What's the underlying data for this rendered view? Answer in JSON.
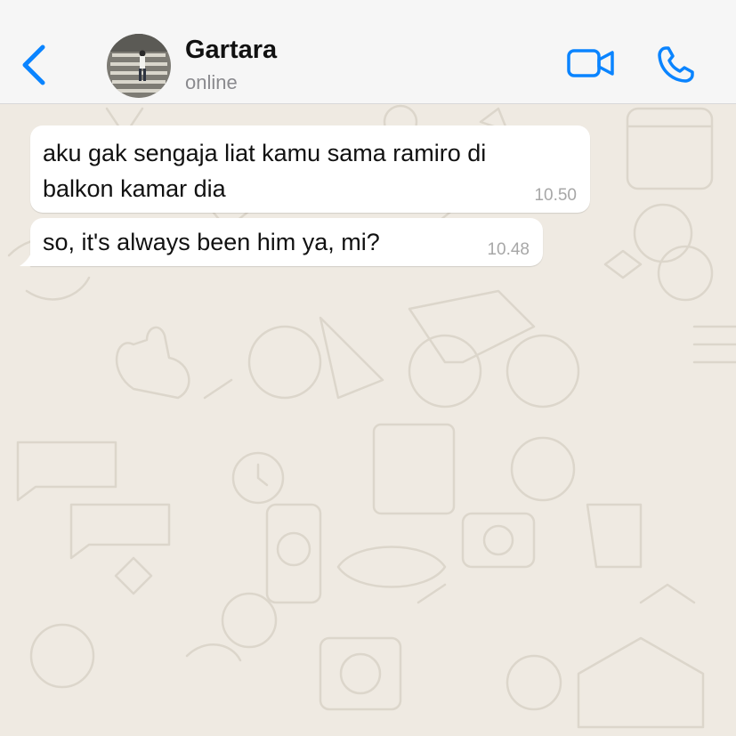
{
  "header": {
    "contact_name": "Gartara",
    "contact_status": "online"
  },
  "icons": {
    "back": "chevron-left-icon",
    "video": "video-camera-icon",
    "call": "phone-icon"
  },
  "colors": {
    "accent": "#0a84ff",
    "chat_background": "#efeae2",
    "bubble": "#ffffff"
  },
  "messages": [
    {
      "lines": [
        "aku gak sengaja liat kamu sama ramiro di",
        "balkon kamar dia"
      ],
      "time": "10.50",
      "direction": "incoming"
    },
    {
      "lines": [
        "so, it's always been him ya, mi?"
      ],
      "time": "10.48",
      "direction": "incoming"
    }
  ]
}
